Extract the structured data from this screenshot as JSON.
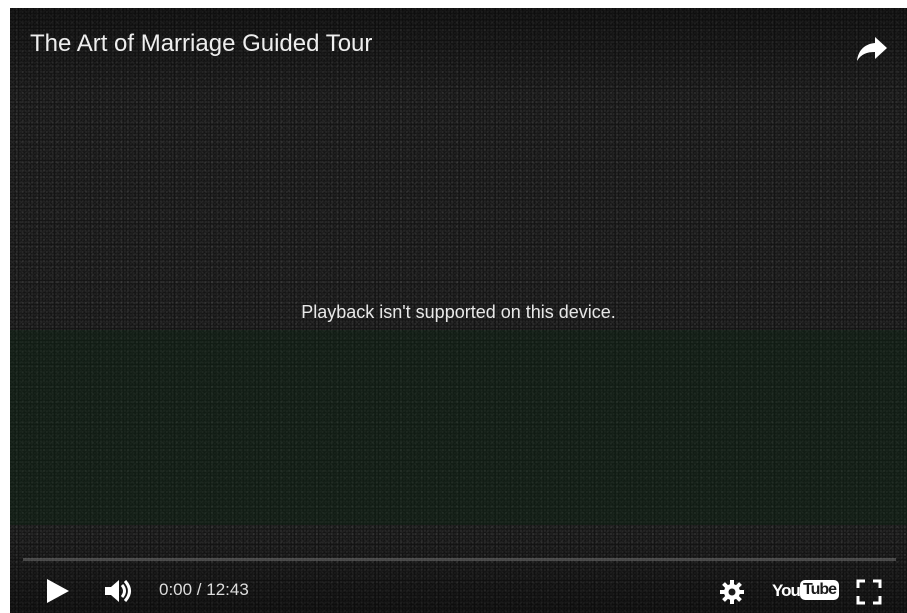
{
  "video": {
    "title": "The Art of Marriage Guided Tour",
    "message": "Playback isn't supported on this device.",
    "progress_fraction": 0
  },
  "controls": {
    "time_display": "0:00 / 12:43",
    "logo_you": "You",
    "logo_tube": "Tube"
  },
  "icons": {
    "share": "share-arrow-icon",
    "play": "play-icon",
    "volume": "volume-icon",
    "settings": "gear-icon",
    "logo": "youtube-logo",
    "fullscreen": "fullscreen-icon"
  },
  "colors": {
    "background": "#141414",
    "text": "#eeeeee",
    "progress_played": "#cc181e"
  }
}
